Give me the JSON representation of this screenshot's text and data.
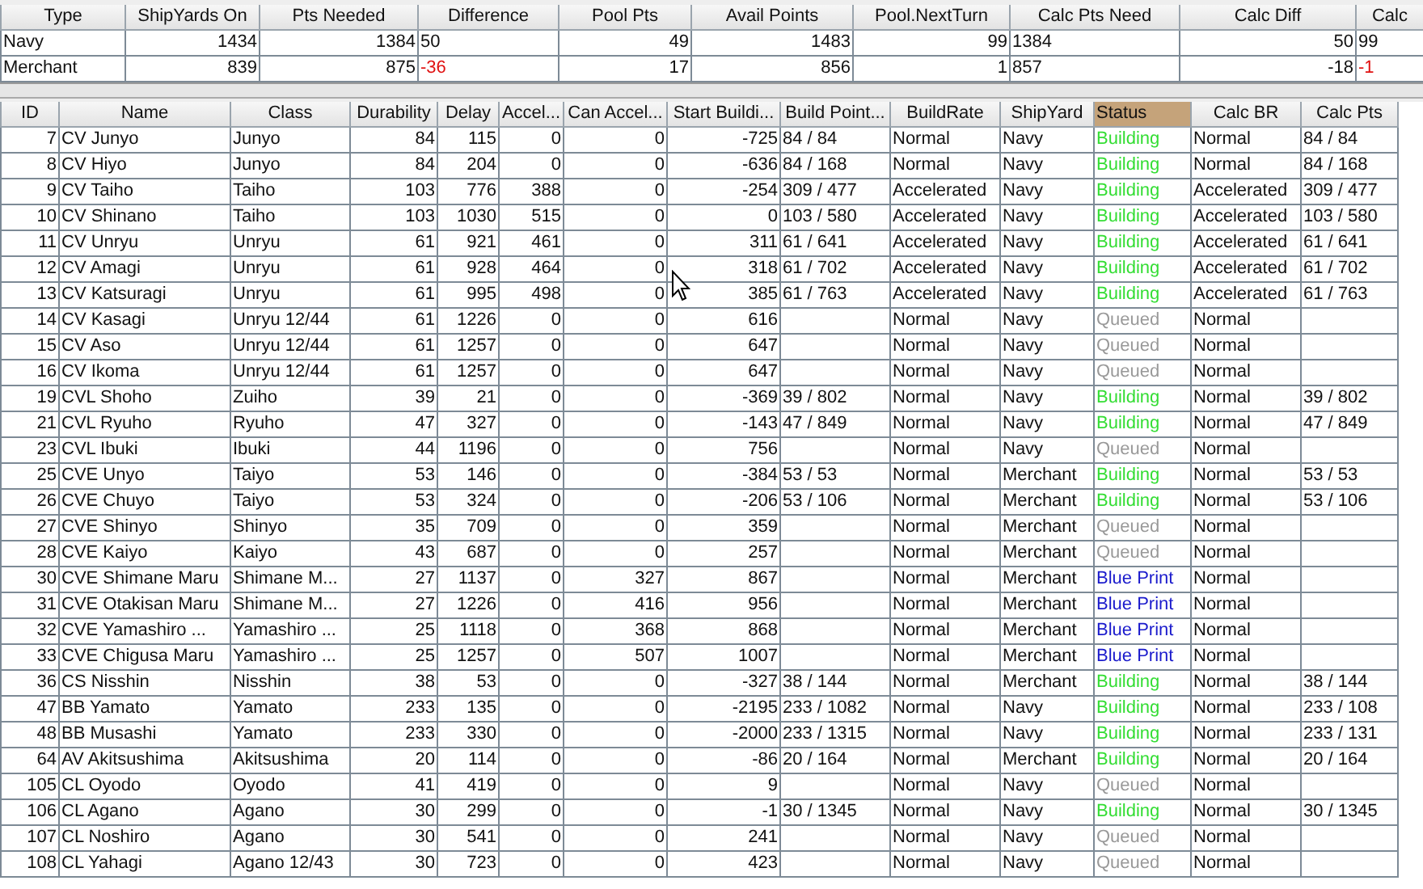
{
  "summary": {
    "columns": [
      "Type",
      "ShipYards On",
      "Pts Needed",
      "Difference",
      "Pool Pts",
      "Avail Points",
      "Pool.NextTurn",
      "Calc Pts Need",
      "Calc Diff",
      "Calc"
    ],
    "rows": [
      {
        "type": "Navy",
        "shipyards_on": "1434",
        "pts_needed": "1384",
        "difference": "50",
        "difference_negative": false,
        "pool_pts": "49",
        "avail_points": "1483",
        "pool_next_turn": "99",
        "calc_pts_need": "1384",
        "calc_diff": "50",
        "calc": "99",
        "calc_negative": false
      },
      {
        "type": "Merchant",
        "shipyards_on": "839",
        "pts_needed": "875",
        "difference": "-36",
        "difference_negative": true,
        "pool_pts": "17",
        "avail_points": "856",
        "pool_next_turn": "1",
        "calc_pts_need": "857",
        "calc_diff": "-18",
        "calc": "-1",
        "calc_negative": true
      }
    ]
  },
  "ships": {
    "columns": [
      {
        "label": "ID",
        "selected": false
      },
      {
        "label": "Name",
        "selected": false
      },
      {
        "label": "Class",
        "selected": false
      },
      {
        "label": "Durability",
        "selected": false
      },
      {
        "label": "Delay",
        "selected": false
      },
      {
        "label": "Accel...",
        "selected": false
      },
      {
        "label": "Can Accel...",
        "selected": false
      },
      {
        "label": "Start Buildi...",
        "selected": false
      },
      {
        "label": "Build Point...",
        "selected": false
      },
      {
        "label": "BuildRate",
        "selected": false
      },
      {
        "label": "ShipYard",
        "selected": false
      },
      {
        "label": "Status",
        "selected": true
      },
      {
        "label": "Calc BR",
        "selected": false
      },
      {
        "label": "Calc Pts",
        "selected": false
      }
    ],
    "rows": [
      {
        "cells": [
          "7",
          "CV Junyo",
          "Junyo",
          "84",
          "115",
          "0",
          "0",
          "-725",
          "84 / 84",
          "Normal",
          "Navy",
          {
            "text": "Building",
            "color": "#33dd33"
          },
          "Normal",
          "84 / 84"
        ]
      },
      {
        "cells": [
          "8",
          "CV Hiyo",
          "Junyo",
          "84",
          "204",
          "0",
          "0",
          "-636",
          "84 / 168",
          "Normal",
          "Navy",
          {
            "text": "Building",
            "color": "#33dd33"
          },
          "Normal",
          "84 / 168"
        ]
      },
      {
        "cells": [
          "9",
          "CV Taiho",
          "Taiho",
          "103",
          "776",
          "388",
          "0",
          "-254",
          "309 / 477",
          "Accelerated",
          "Navy",
          {
            "text": "Building",
            "color": "#33dd33"
          },
          "Accelerated",
          "309 / 477"
        ]
      },
      {
        "cells": [
          "10",
          "CV Shinano",
          "Taiho",
          "103",
          "1030",
          "515",
          "0",
          "0",
          "103 / 580",
          "Accelerated",
          "Navy",
          {
            "text": "Building",
            "color": "#33dd33"
          },
          "Accelerated",
          "103 / 580"
        ]
      },
      {
        "cells": [
          "11",
          "CV Unryu",
          "Unryu",
          "61",
          "921",
          "461",
          "0",
          "311",
          "61 / 641",
          "Accelerated",
          "Navy",
          {
            "text": "Building",
            "color": "#33dd33"
          },
          "Accelerated",
          "61 / 641"
        ]
      },
      {
        "cells": [
          "12",
          "CV Amagi",
          "Unryu",
          "61",
          "928",
          "464",
          "0",
          "318",
          "61 / 702",
          "Accelerated",
          "Navy",
          {
            "text": "Building",
            "color": "#33dd33"
          },
          "Accelerated",
          "61 / 702"
        ]
      },
      {
        "cells": [
          "13",
          "CV Katsuragi",
          "Unryu",
          "61",
          "995",
          "498",
          "0",
          "385",
          "61 / 763",
          "Accelerated",
          "Navy",
          {
            "text": "Building",
            "color": "#33dd33"
          },
          "Accelerated",
          "61 / 763"
        ]
      },
      {
        "cells": [
          "14",
          "CV Kasagi",
          "Unryu 12/44",
          "61",
          "1226",
          "0",
          "0",
          "616",
          null,
          "Normal",
          "Navy",
          {
            "text": "Queued",
            "color": "#999999"
          },
          "Normal",
          null
        ]
      },
      {
        "cells": [
          "15",
          "CV Aso",
          "Unryu 12/44",
          "61",
          "1257",
          "0",
          "0",
          "647",
          null,
          "Normal",
          "Navy",
          {
            "text": "Queued",
            "color": "#999999"
          },
          "Normal",
          null
        ]
      },
      {
        "cells": [
          "16",
          "CV Ikoma",
          "Unryu 12/44",
          "61",
          "1257",
          "0",
          "0",
          "647",
          null,
          "Normal",
          "Navy",
          {
            "text": "Queued",
            "color": "#999999"
          },
          "Normal",
          null
        ]
      },
      {
        "cells": [
          "19",
          "CVL Shoho",
          "Zuiho",
          "39",
          "21",
          "0",
          "0",
          "-369",
          "39 / 802",
          "Normal",
          "Navy",
          {
            "text": "Building",
            "color": "#33dd33"
          },
          "Normal",
          "39 / 802"
        ]
      },
      {
        "cells": [
          "21",
          "CVL Ryuho",
          "Ryuho",
          "47",
          "327",
          "0",
          "0",
          "-143",
          "47 / 849",
          "Normal",
          "Navy",
          {
            "text": "Building",
            "color": "#33dd33"
          },
          "Normal",
          "47 / 849"
        ]
      },
      {
        "cells": [
          "23",
          "CVL Ibuki",
          "Ibuki",
          "44",
          "1196",
          "0",
          "0",
          "756",
          null,
          "Normal",
          "Navy",
          {
            "text": "Queued",
            "color": "#999999"
          },
          "Normal",
          null
        ]
      },
      {
        "cells": [
          "25",
          "CVE Unyo",
          "Taiyo",
          "53",
          "146",
          "0",
          "0",
          "-384",
          "53 / 53",
          "Normal",
          "Merchant",
          {
            "text": "Building",
            "color": "#33dd33"
          },
          "Normal",
          "53 / 53"
        ]
      },
      {
        "cells": [
          "26",
          "CVE Chuyo",
          "Taiyo",
          "53",
          "324",
          "0",
          "0",
          "-206",
          "53 / 106",
          "Normal",
          "Merchant",
          {
            "text": "Building",
            "color": "#33dd33"
          },
          "Normal",
          "53 / 106"
        ]
      },
      {
        "cells": [
          "27",
          "CVE Shinyo",
          "Shinyo",
          "35",
          "709",
          "0",
          "0",
          "359",
          null,
          "Normal",
          "Merchant",
          {
            "text": "Queued",
            "color": "#999999"
          },
          "Normal",
          null
        ]
      },
      {
        "cells": [
          "28",
          "CVE Kaiyo",
          "Kaiyo",
          "43",
          "687",
          "0",
          "0",
          "257",
          null,
          "Normal",
          "Merchant",
          {
            "text": "Queued",
            "color": "#999999"
          },
          "Normal",
          null
        ]
      },
      {
        "cells": [
          "30",
          "CVE Shimane Maru",
          "Shimane M...",
          "27",
          "1137",
          "0",
          "327",
          "867",
          null,
          "Normal",
          "Merchant",
          {
            "text": "Blue Print",
            "color": "#1a1acc"
          },
          "Normal",
          null
        ]
      },
      {
        "cells": [
          "31",
          "CVE Otakisan Maru",
          "Shimane M...",
          "27",
          "1226",
          "0",
          "416",
          "956",
          null,
          "Normal",
          "Merchant",
          {
            "text": "Blue Print",
            "color": "#1a1acc"
          },
          "Normal",
          null
        ]
      },
      {
        "cells": [
          "32",
          "CVE Yamashiro ...",
          "Yamashiro ...",
          "25",
          "1118",
          "0",
          "368",
          "868",
          null,
          "Normal",
          "Merchant",
          {
            "text": "Blue Print",
            "color": "#1a1acc"
          },
          "Normal",
          null
        ]
      },
      {
        "cells": [
          "33",
          "CVE Chigusa Maru",
          "Yamashiro ...",
          "25",
          "1257",
          "0",
          "507",
          "1007",
          null,
          "Normal",
          "Merchant",
          {
            "text": "Blue Print",
            "color": "#1a1acc"
          },
          "Normal",
          null
        ]
      },
      {
        "cells": [
          "36",
          "CS Nisshin",
          "Nisshin",
          "38",
          "53",
          "0",
          "0",
          "-327",
          "38 / 144",
          "Normal",
          "Merchant",
          {
            "text": "Building",
            "color": "#33dd33"
          },
          "Normal",
          "38 / 144"
        ]
      },
      {
        "cells": [
          "47",
          "BB Yamato",
          "Yamato",
          "233",
          "135",
          "0",
          "0",
          "-2195",
          "233 / 1082",
          "Normal",
          "Navy",
          {
            "text": "Building",
            "color": "#33dd33"
          },
          "Normal",
          "233 / 108"
        ]
      },
      {
        "cells": [
          "48",
          "BB Musashi",
          "Yamato",
          "233",
          "330",
          "0",
          "0",
          "-2000",
          "233 / 1315",
          "Normal",
          "Navy",
          {
            "text": "Building",
            "color": "#33dd33"
          },
          "Normal",
          "233 / 131"
        ]
      },
      {
        "cells": [
          "64",
          "AV Akitsushima",
          "Akitsushima",
          "20",
          "114",
          "0",
          "0",
          "-86",
          "20 / 164",
          "Normal",
          "Merchant",
          {
            "text": "Building",
            "color": "#33dd33"
          },
          "Normal",
          "20 / 164"
        ]
      },
      {
        "cells": [
          "105",
          "CL Oyodo",
          "Oyodo",
          "41",
          "419",
          "0",
          "0",
          "9",
          null,
          "Normal",
          "Navy",
          {
            "text": "Queued",
            "color": "#999999"
          },
          "Normal",
          null
        ]
      },
      {
        "cells": [
          "106",
          "CL Agano",
          "Agano",
          "30",
          "299",
          "0",
          "0",
          "-1",
          "30 / 1345",
          "Normal",
          "Navy",
          {
            "text": "Building",
            "color": "#33dd33"
          },
          "Normal",
          "30 / 1345"
        ]
      },
      {
        "cells": [
          "107",
          "CL Noshiro",
          "Agano",
          "30",
          "541",
          "0",
          "0",
          "241",
          null,
          "Normal",
          "Navy",
          {
            "text": "Queued",
            "color": "#999999"
          },
          "Normal",
          null
        ]
      },
      {
        "cells": [
          "108",
          "CL Yahagi",
          "Agano 12/43",
          "30",
          "723",
          "0",
          "0",
          "423",
          null,
          "Normal",
          "Navy",
          {
            "text": "Queued",
            "color": "#999999"
          },
          "Normal",
          null
        ]
      }
    ]
  }
}
